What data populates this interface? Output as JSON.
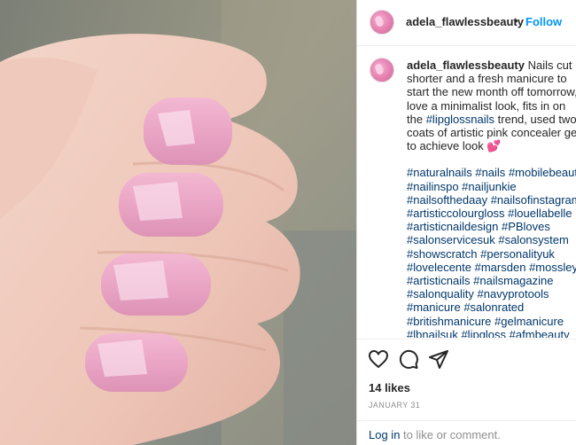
{
  "post": {
    "username": "adela_flawlessbeauty",
    "separator": "•",
    "follow_label": "Follow",
    "caption_text": "Nails cut shorter and a fresh manicure to start the new month off tomorrow, love a minimalist look, fits in on the",
    "caption_tag": "#lipglossnails",
    "caption_tail": "trend, used two coats of artistic pink concealer gel to achieve look 💕",
    "hashtags": [
      "#naturalnails",
      "#nails",
      "#mobilebeauty",
      "#nailinspo",
      "#nailjunkie",
      "#nailsofthedaay",
      "#nailsofinstagram",
      "#artisticcolourgloss",
      "#louellabelle",
      "#artisticnaildesign",
      "#PBloves",
      "#salonservicesuk",
      "#salonsystem",
      "#showscratch",
      "#personalityuk",
      "#lovelecente",
      "#marsden",
      "#mossley",
      "#artisticnails",
      "#nailsmagazine",
      "#salonquality",
      "#navyprotools",
      "#manicure",
      "#salonrated",
      "#britishmanicure",
      "#gelmanicure",
      "#lbnailsuk",
      "#lipgloss",
      "#afmbeauty"
    ],
    "likes": "14 likes",
    "date": "JANUARY 31",
    "login_link": "Log in",
    "login_rest": "to like or comment."
  },
  "icons": {
    "like": "heart-icon",
    "comment": "comment-icon",
    "share": "share-icon"
  },
  "colors": {
    "link_blue": "#0095f6",
    "hashtag": "#00376b",
    "nail_pink": "#e9a6c6"
  }
}
